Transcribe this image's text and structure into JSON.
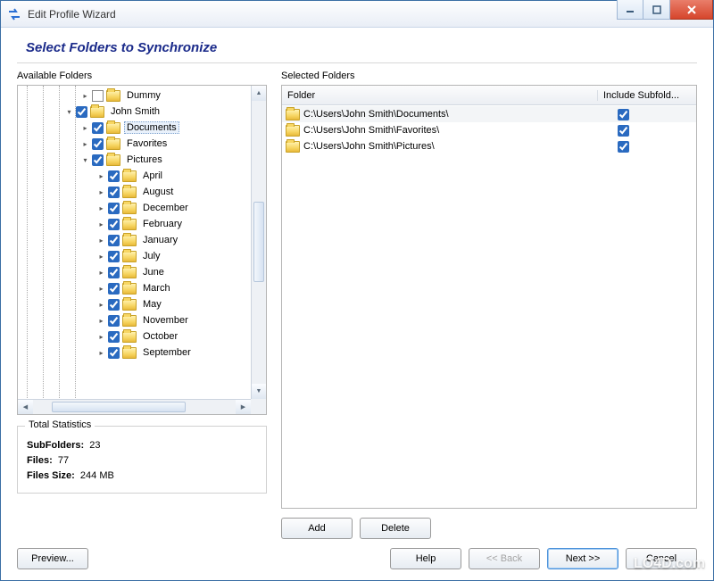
{
  "window": {
    "title": "Edit Profile Wizard"
  },
  "heading": "Select Folders to Synchronize",
  "labels": {
    "available": "Available Folders",
    "selected": "Selected Folders",
    "folder_col": "Folder",
    "include_col": "Include Subfold..."
  },
  "tree": [
    {
      "indent": 2,
      "exp": ">",
      "check": "blank",
      "name": "Dummy"
    },
    {
      "indent": 1,
      "exp": "v",
      "check": true,
      "name": "John Smith"
    },
    {
      "indent": 2,
      "exp": ">",
      "check": true,
      "name": "Documents",
      "selected": true
    },
    {
      "indent": 2,
      "exp": ">",
      "check": true,
      "name": "Favorites"
    },
    {
      "indent": 2,
      "exp": "v",
      "check": true,
      "name": "Pictures"
    },
    {
      "indent": 3,
      "exp": ">",
      "check": true,
      "name": "April"
    },
    {
      "indent": 3,
      "exp": ">",
      "check": true,
      "name": "August"
    },
    {
      "indent": 3,
      "exp": ">",
      "check": true,
      "name": "December"
    },
    {
      "indent": 3,
      "exp": ">",
      "check": true,
      "name": "February"
    },
    {
      "indent": 3,
      "exp": ">",
      "check": true,
      "name": "January"
    },
    {
      "indent": 3,
      "exp": ">",
      "check": true,
      "name": "July"
    },
    {
      "indent": 3,
      "exp": ">",
      "check": true,
      "name": "June"
    },
    {
      "indent": 3,
      "exp": ">",
      "check": true,
      "name": "March"
    },
    {
      "indent": 3,
      "exp": ">",
      "check": true,
      "name": "May"
    },
    {
      "indent": 3,
      "exp": ">",
      "check": true,
      "name": "November"
    },
    {
      "indent": 3,
      "exp": ">",
      "check": true,
      "name": "October"
    },
    {
      "indent": 3,
      "exp": ">",
      "check": true,
      "name": "September"
    }
  ],
  "selected_rows": [
    {
      "path": "C:\\Users\\John Smith\\Documents\\",
      "include": true,
      "sel": true
    },
    {
      "path": "C:\\Users\\John Smith\\Favorites\\",
      "include": true
    },
    {
      "path": "C:\\Users\\John Smith\\Pictures\\",
      "include": true
    }
  ],
  "stats": {
    "legend": "Total Statistics",
    "subfolders_label": "SubFolders:",
    "subfolders_value": "23",
    "files_label": "Files:",
    "files_value": "77",
    "size_label": "Files Size:",
    "size_value": "244 MB"
  },
  "buttons": {
    "add": "Add",
    "delete": "Delete",
    "preview": "Preview...",
    "help": "Help",
    "back": "<< Back",
    "next": "Next >>",
    "cancel": "Cancel"
  },
  "watermark": "LO4D.com"
}
